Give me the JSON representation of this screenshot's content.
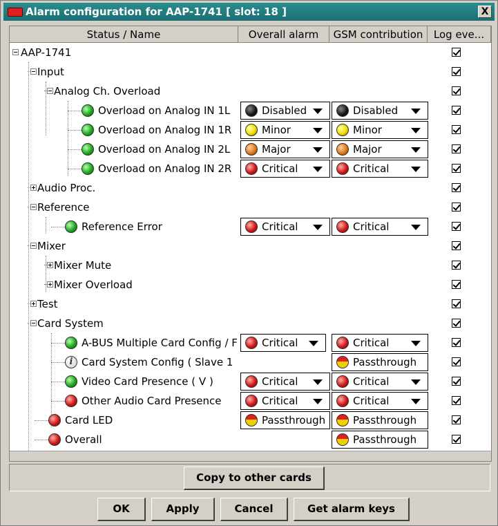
{
  "window": {
    "title": "Alarm configuration for AAP-1741 [ slot: 18 ]",
    "close_label": "X"
  },
  "columns": [
    "Status / Name",
    "Overall alarm",
    "GSM contribution",
    "Log eve..."
  ],
  "rows": [
    {
      "label": "AAP-1741",
      "log": true
    },
    {
      "label": "Input",
      "log": true
    },
    {
      "label": "Analog Ch. Overload",
      "log": true
    },
    {
      "label": "Overload on Analog IN 1L",
      "overall": "Disabled",
      "gsm": "Disabled",
      "log": true
    },
    {
      "label": "Overload on Analog IN 1R",
      "overall": "Minor",
      "gsm": "Minor",
      "log": true
    },
    {
      "label": "Overload on Analog IN 2L",
      "overall": "Major",
      "gsm": "Major",
      "log": true
    },
    {
      "label": "Overload on Analog IN 2R",
      "overall": "Critical",
      "gsm": "Critical",
      "log": true
    },
    {
      "label": "Audio Proc.",
      "log": true
    },
    {
      "label": "Reference",
      "log": true
    },
    {
      "label": "Reference Error",
      "overall": "Critical",
      "gsm": "Critical",
      "log": true
    },
    {
      "label": "Mixer",
      "log": true
    },
    {
      "label": "Mixer Mute",
      "log": true
    },
    {
      "label": "Mixer Overload",
      "log": true
    },
    {
      "label": "Test",
      "log": true
    },
    {
      "label": "Card System",
      "log": true
    },
    {
      "label": "A-BUS Multiple Card Config / F",
      "overall": "Critical",
      "gsm": "Critical",
      "log": true
    },
    {
      "label": "Card System Config ( Slave 1",
      "gsm": "Passthrough",
      "log": true
    },
    {
      "label": "Video Card Presence ( V )",
      "overall": "Critical",
      "gsm": "Critical",
      "log": true
    },
    {
      "label": "Other Audio Card Presence",
      "overall": "Critical",
      "gsm": "Critical",
      "log": true
    },
    {
      "label": "Card LED",
      "overall": "Passthrough",
      "gsm": "Passthrough",
      "log": true
    },
    {
      "label": "Overall",
      "gsm": "Passthrough",
      "log": true
    }
  ],
  "buttons": {
    "copy": "Copy to other cards",
    "ok": "OK",
    "apply": "Apply",
    "cancel": "Cancel",
    "get_keys": "Get alarm keys"
  },
  "colors": {
    "titlebar": "#1b6f74",
    "disabled": "#111111",
    "minor": "#f0e000",
    "major": "#e07a20",
    "critical": "#d01818",
    "status_ok": "#1fa81f"
  }
}
